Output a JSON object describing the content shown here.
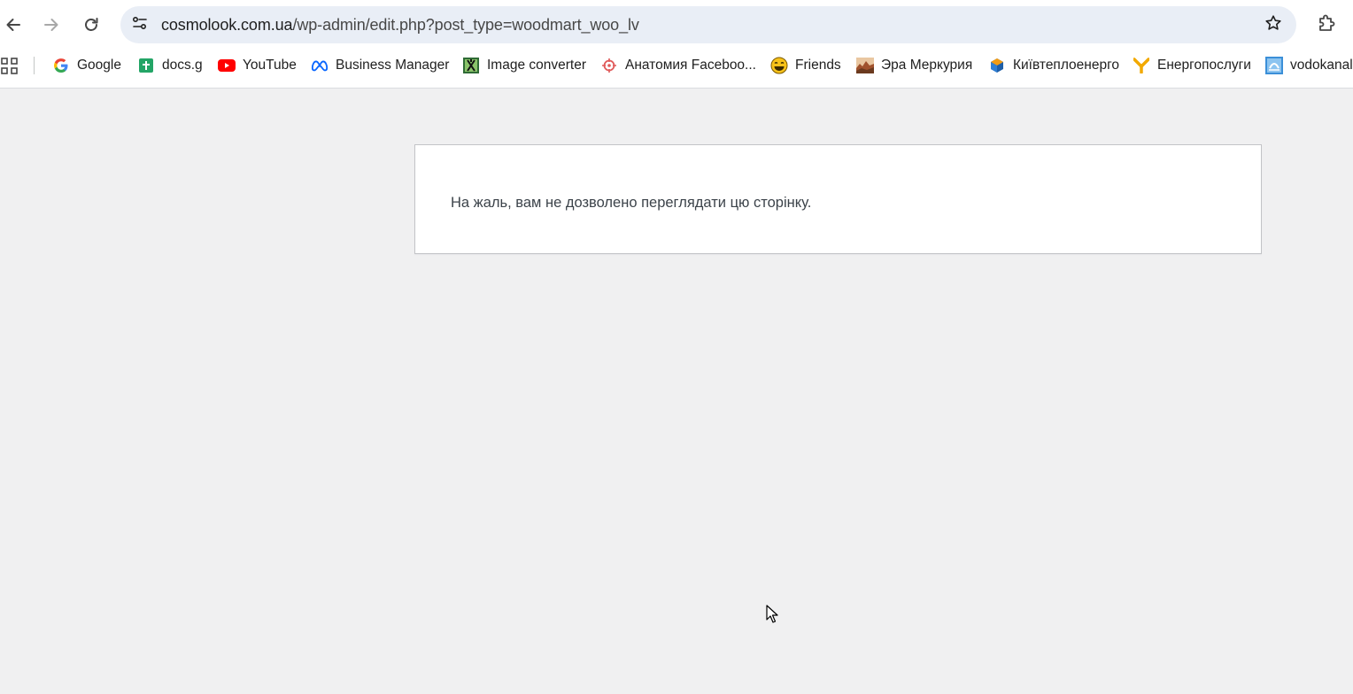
{
  "browser": {
    "url": {
      "domain": "cosmolook.com.ua",
      "path": "/wp-admin/edit.php?post_type=woodmart_woo_lv"
    },
    "icons": {
      "back": "arrow-left-icon",
      "forward": "arrow-right-icon",
      "reload": "reload-icon",
      "site_info": "tune-icon",
      "bookmark_star": "star-icon",
      "extensions": "puzzle-icon",
      "apps": "grid-icon"
    }
  },
  "bookmarks": [
    {
      "label": "Google",
      "icon": "google-icon"
    },
    {
      "label": "docs.g",
      "icon": "sheets-icon"
    },
    {
      "label": "YouTube",
      "icon": "youtube-icon"
    },
    {
      "label": "Business Manager",
      "icon": "meta-icon"
    },
    {
      "label": "Image converter",
      "icon": "image-converter-icon"
    },
    {
      "label": "Анатомия Faceboo...",
      "icon": "target-icon"
    },
    {
      "label": "Friends",
      "icon": "smiley-icon"
    },
    {
      "label": "Эра Меркурия",
      "icon": "landscape-icon"
    },
    {
      "label": "Київтеплоенерго",
      "icon": "cube-icon"
    },
    {
      "label": "Енергопослуги",
      "icon": "y-logo-icon"
    },
    {
      "label": "vodokanal",
      "icon": "vodokanal-icon"
    }
  ],
  "page": {
    "error_message": "На жаль, вам не дозволено переглядати цю сторінку."
  },
  "colors": {
    "page_background": "#f0f0f1",
    "omnibox_background": "#e9eef6",
    "message_text": "#3c434a"
  }
}
